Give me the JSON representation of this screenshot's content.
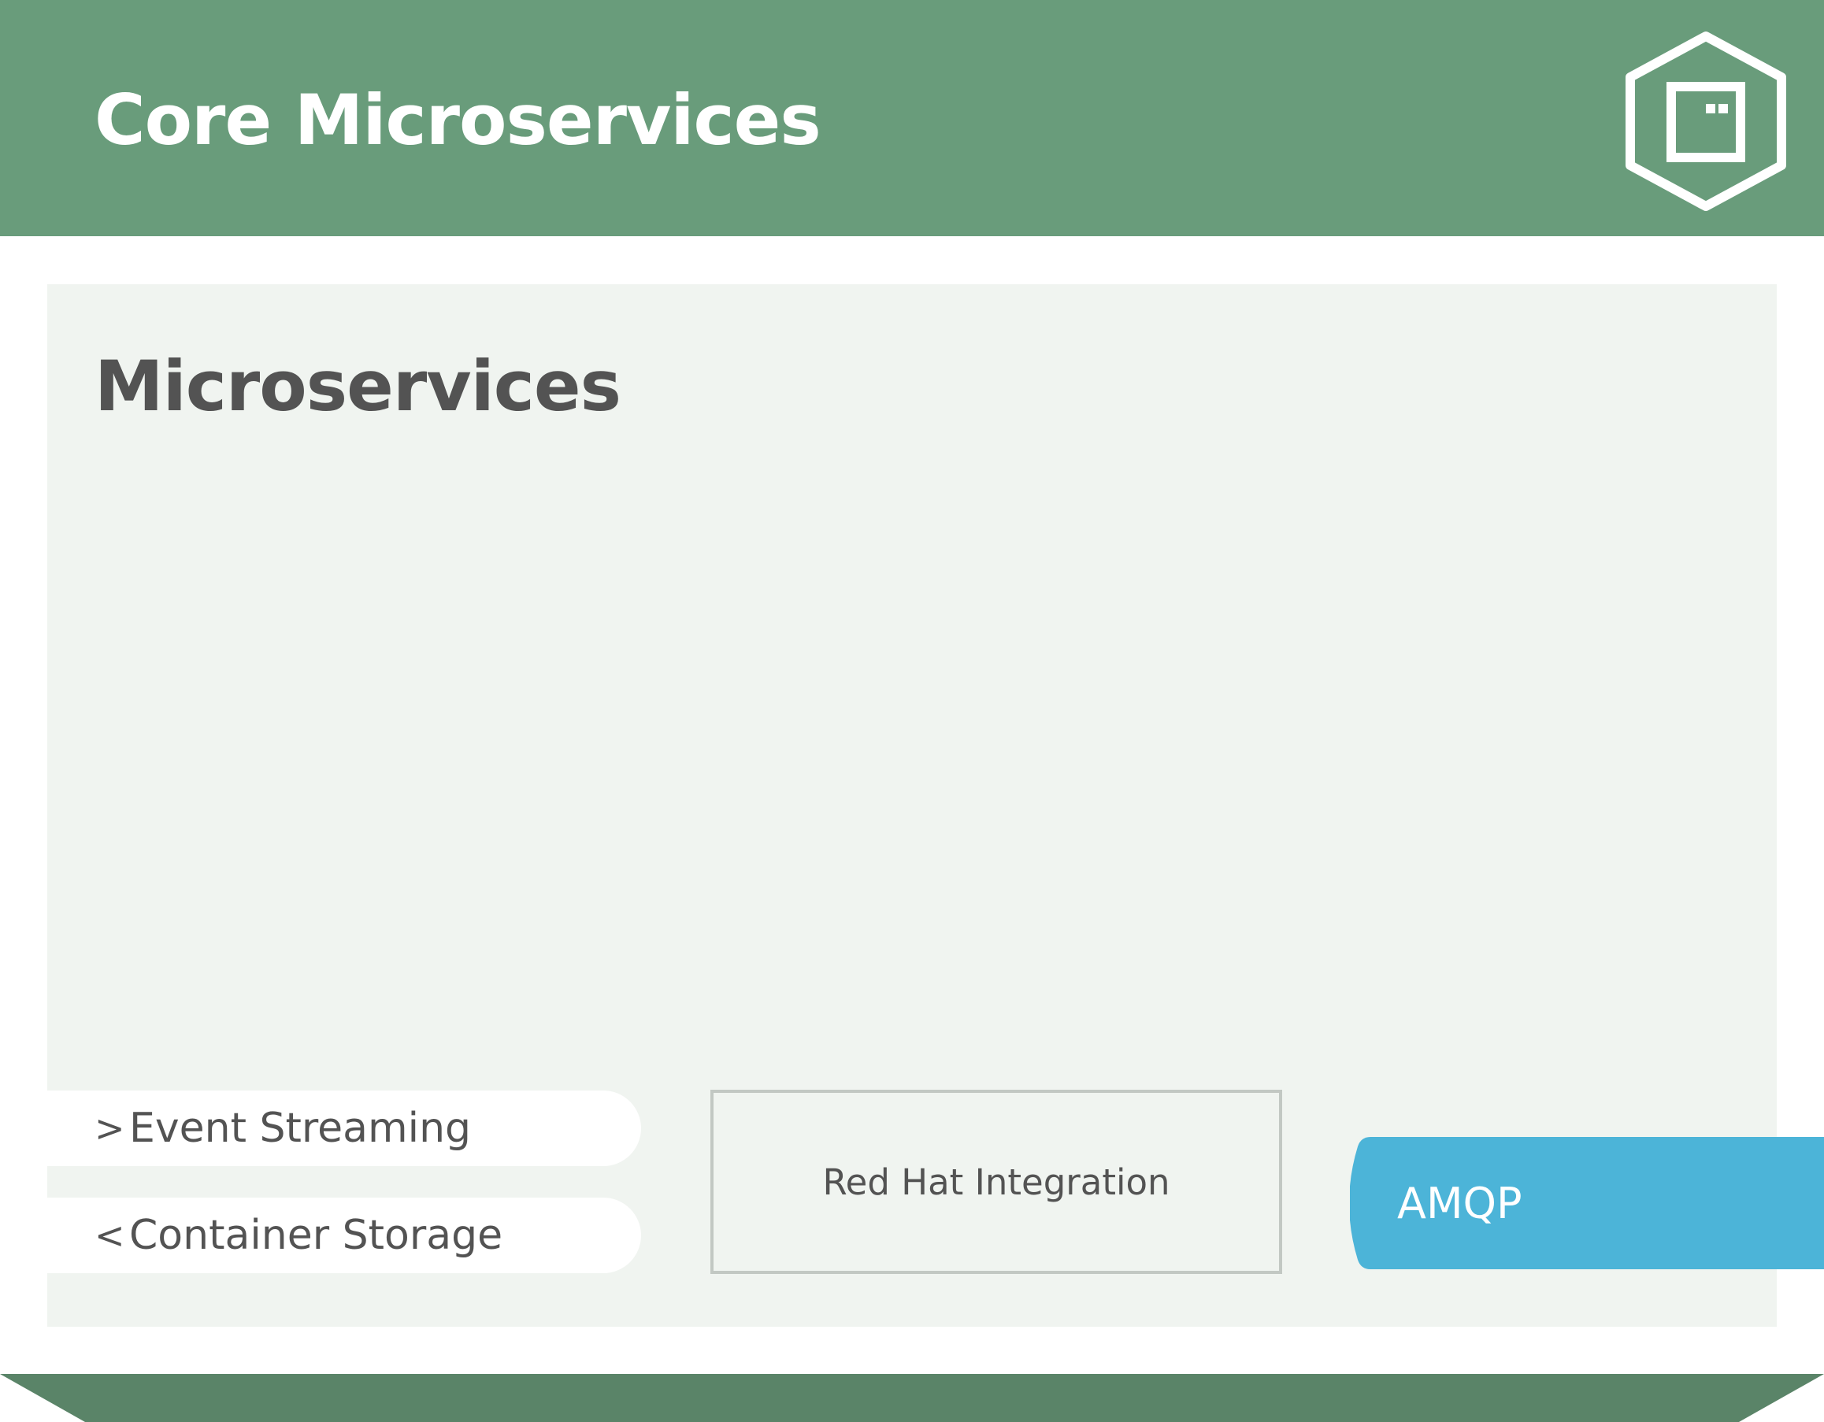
{
  "header": {
    "title": "Core Microservices",
    "icon": "container-hexagon-icon"
  },
  "panel": {
    "title": "Microservices"
  },
  "tags": [
    {
      "label": "Event Streaming",
      "prefix": ">"
    },
    {
      "label": "Container Storage",
      "prefix": "<"
    }
  ],
  "center_box": {
    "label": "Red Hat Integration"
  },
  "protocol_tag": {
    "label": "AMQP"
  },
  "colors": {
    "header_green": "#699c7b",
    "footer_green": "#5a8468",
    "panel_bg": "#f0f4f0",
    "text_dark": "#535353",
    "box_border": "#c2c8c3",
    "amqp_blue": "#4cb4d8"
  }
}
